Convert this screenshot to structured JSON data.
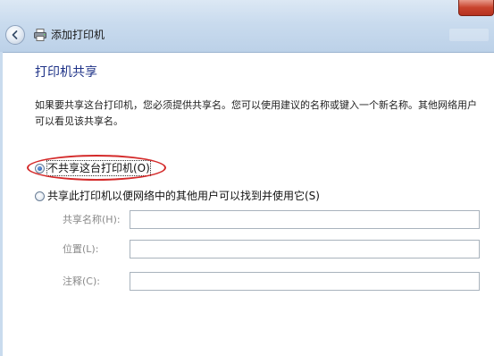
{
  "window": {
    "title": "添加打印机",
    "back_icon": "back-arrow-icon",
    "printer_icon": "printer-icon"
  },
  "page": {
    "heading": "打印机共享",
    "description": "如果要共享这台打印机，您必须提供共享名。您可以使用建议的名称或键入一个新名称。其他网络用户可以看见该共享名。"
  },
  "options": {
    "no_share": {
      "label": "不共享这台打印机(O)",
      "checked": true
    },
    "share": {
      "label": "共享此打印机以便网络中的其他用户可以找到并使用它(S)",
      "checked": false
    }
  },
  "fields": {
    "share_name": {
      "label": "共享名称(H):",
      "value": ""
    },
    "location": {
      "label": "位置(L):",
      "value": ""
    },
    "comment": {
      "label": "注释(C):",
      "value": ""
    }
  },
  "colors": {
    "heading": "#1e3287",
    "annotation_ellipse": "#d42a2a",
    "titlebar": "#c9dbee"
  }
}
